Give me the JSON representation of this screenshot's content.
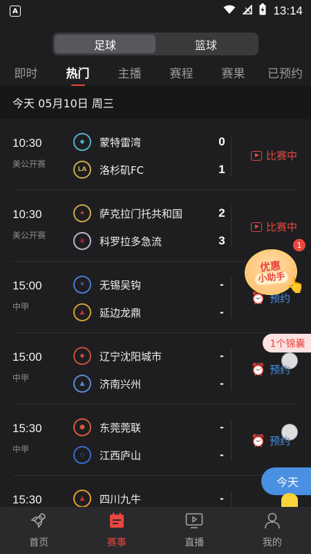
{
  "status_bar": {
    "time": "13:14",
    "app_icon": "A"
  },
  "segment": {
    "items": [
      "足球",
      "篮球"
    ],
    "active": 0
  },
  "tabs": [
    {
      "label": "即时"
    },
    {
      "label": "热门",
      "active": true
    },
    {
      "label": "主播"
    },
    {
      "label": "赛程"
    },
    {
      "label": "赛果"
    },
    {
      "label": "已预约"
    }
  ],
  "date_header": "今天 05月10日 周三",
  "matches": [
    {
      "time": "10:30",
      "league": "美公开赛",
      "home": {
        "name": "蒙特雷湾",
        "score": "0"
      },
      "away": {
        "name": "洛杉矶FC",
        "score": "1"
      },
      "status": "比赛中"
    },
    {
      "time": "10:30",
      "league": "美公开赛",
      "home": {
        "name": "萨克拉门托共和国",
        "score": "2"
      },
      "away": {
        "name": "科罗拉多急流",
        "score": "3"
      },
      "status": "比赛中"
    },
    {
      "time": "15:00",
      "league": "中甲",
      "home": {
        "name": "无锡吴钩",
        "score": "-"
      },
      "away": {
        "name": "延边龙鼎",
        "score": "-"
      },
      "status": "预约"
    },
    {
      "time": "15:00",
      "league": "中甲",
      "home": {
        "name": "辽宁沈阳城市",
        "score": "-"
      },
      "away": {
        "name": "济南兴州",
        "score": "-"
      },
      "status": "预约"
    },
    {
      "time": "15:30",
      "league": "中甲",
      "home": {
        "name": "东莞莞联",
        "score": "-"
      },
      "away": {
        "name": "江西庐山",
        "score": "-"
      },
      "status": "预约"
    },
    {
      "time": "15:30",
      "league": "",
      "home": {
        "name": "四川九牛",
        "score": "-"
      },
      "away": {
        "name": "",
        "score": ""
      },
      "status": ""
    }
  ],
  "overlays": {
    "promo_line1": "优惠",
    "promo_line2": "小助手",
    "promo_badge": "1",
    "jinnang": "1个锦囊",
    "today": "今天"
  },
  "bottom_nav": [
    {
      "label": "首页",
      "icon": "rocket-icon"
    },
    {
      "label": "赛事",
      "icon": "calendar-icon",
      "active": true
    },
    {
      "label": "直播",
      "icon": "tv-play-icon"
    },
    {
      "label": "我的",
      "icon": "user-icon"
    }
  ],
  "colors": {
    "accent": "#e8463e",
    "booking": "#4a90e2",
    "background": "#1e1e20"
  }
}
